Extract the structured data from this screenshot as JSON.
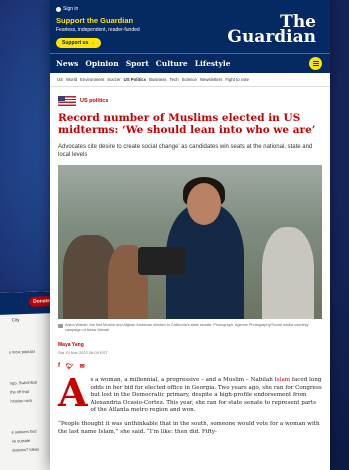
{
  "background_page": {
    "donate_label": "Donate",
    "city_label": "City",
    "lines": [
      "s most popular",
      "ngo. Switchfoot",
      "the riff that",
      "hristian rock",
      "e seekers find",
      "ve outside",
      "stations? Ideas"
    ]
  },
  "masthead": {
    "signin_label": "Sign in",
    "support_title": "Support the Guardian",
    "support_sub": "Fearless, independent, reader-funded",
    "support_btn": "Support us →",
    "logo_line1": "The",
    "logo_line2": "Guardian"
  },
  "nav": {
    "items": [
      "News",
      "Opinion",
      "Sport",
      "Culture",
      "Lifestyle"
    ]
  },
  "subnav": {
    "items": [
      "US",
      "World",
      "Environment",
      "Soccer",
      "US Politics",
      "Business",
      "Tech",
      "Science",
      "Newsletters",
      "Fight to vote"
    ],
    "active_index": 4
  },
  "article": {
    "kicker": "US politics",
    "headline": "Record number of Muslims elected in US midterms: ‘We should lean into who we are’",
    "standfirst": "Advocates cite desire to create social change’ as candidates win seats at the national, state and local levels",
    "caption": "Aisha Wahab, the first Muslim and Afghan American elected to California’s state senate. Photograph: Agence Photography/Social media courtesy campaign of Aisha Wahab",
    "byline": "Maya Yang",
    "dateline": "Sat 19 Nov 2022 08.00 EST",
    "share_icons": [
      "facebook-icon",
      "twitter-icon",
      "email-icon"
    ],
    "dropcap": "A",
    "para1_a": "s a woman, a millennial, a progressive – and a Muslim – Nabilah ",
    "para1_link": "Islam",
    "para1_b": " faced long odds in her bid for elected office in Georgia. Two years ago, she ran for Congress but lost in the Democratic primary, despite a high-profile endorsement from Alexandria Ocasio-Cortez. This year, she ran for state senate to represent parts of the Atlanta metro region and won.",
    "para2": "“People thought it was unthinkable that in the south, someone would vote for a woman with the last name Islam,” she said. “I’m like: then did. Fifty-"
  },
  "colors": {
    "guardian_blue": "#052962",
    "accent_yellow": "#ffe500",
    "news_red": "#c70000"
  }
}
